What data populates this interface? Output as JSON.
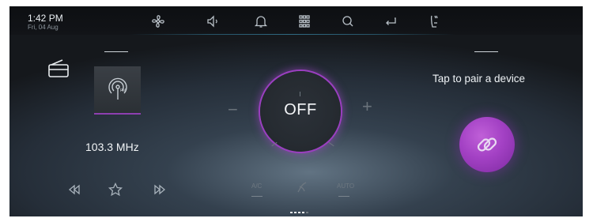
{
  "status": {
    "time": "1:42 PM",
    "date": "Fri, 04 Aug",
    "icons": [
      "fan-icon",
      "speaker-icon",
      "bell-icon",
      "apps-grid-icon",
      "search-icon",
      "back-icon",
      "seat-heat-icon"
    ]
  },
  "radio": {
    "frequency": "103.3 MHz",
    "band_icon": "fm-antenna-icon",
    "controls": [
      "rewind-icon",
      "favorite-star-icon",
      "fast-forward-icon"
    ]
  },
  "climate": {
    "state": "OFF",
    "decrease": "−",
    "increase": "+",
    "mini_left": "A/C",
    "mini_right": "AUTO"
  },
  "pairing": {
    "prompt": "Tap to pair a device",
    "icon": "link-icon"
  },
  "pager": {
    "pages": 5,
    "current": 4
  },
  "colors": {
    "accent": "#a341c4",
    "text": "#f1f4f6"
  }
}
